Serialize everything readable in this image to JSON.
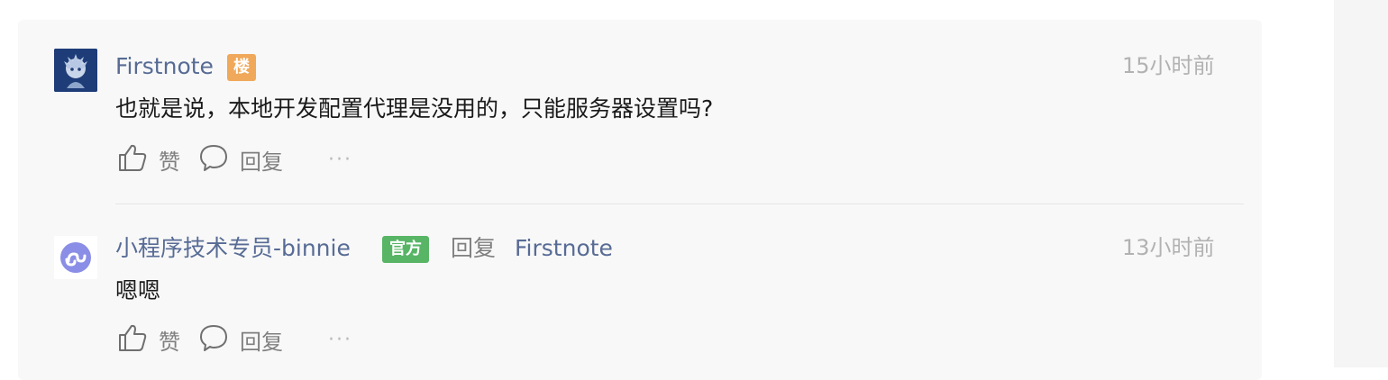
{
  "comments": [
    {
      "author": "Firstnote",
      "badge": "楼",
      "time": "15小时前",
      "text": "也就是说，本地开发配置代理是没用的，只能服务器设置吗?",
      "like_label": "赞",
      "reply_label": "回复",
      "more": "···"
    },
    {
      "author": "小程序技术专员-binnie",
      "badge": "官方",
      "reply_word": "回复",
      "reply_to": "Firstnote",
      "time": "13小时前",
      "text": "嗯嗯",
      "like_label": "赞",
      "reply_label": "回复",
      "more": "···"
    }
  ],
  "colors": {
    "name": "#576b95",
    "floor_badge": "#f0a85a",
    "official_badge": "#58b566",
    "time": "#b2b2b2"
  }
}
